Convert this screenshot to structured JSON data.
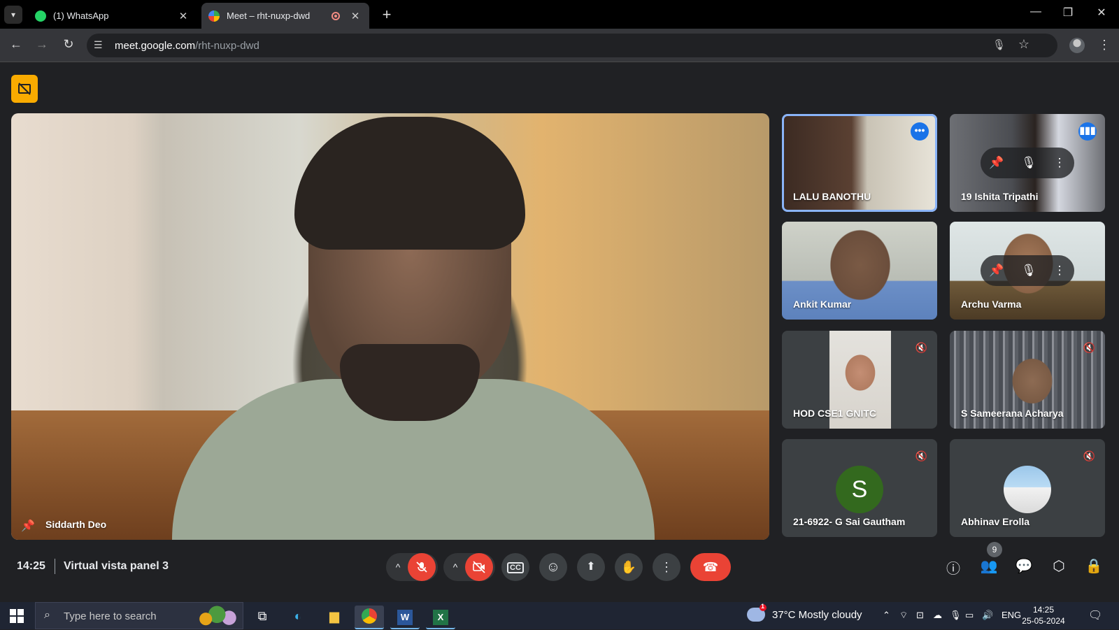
{
  "browser": {
    "tabs": [
      {
        "title": "(1) WhatsApp",
        "close": "✕"
      },
      {
        "title": "Meet – rht-nuxp-dwd",
        "close": "✕"
      }
    ],
    "url_host": "meet.google.com",
    "url_path": "/rht-nuxp-dwd"
  },
  "meet": {
    "main_speaker": "Siddarth Deo",
    "participants": [
      {
        "name": "LALU BANOTHU"
      },
      {
        "name": "19 Ishita Tripathi"
      },
      {
        "name": "Ankit Kumar"
      },
      {
        "name": "Archu Varma"
      },
      {
        "name": "HOD CSE1 GNITC"
      },
      {
        "name": "S Sameerana Acharya"
      },
      {
        "name": "21-6922- G Sai Gautham",
        "avatar_letter": "S"
      },
      {
        "name": "Abhinav Erolla"
      }
    ],
    "time": "14:25",
    "meeting_name": "Virtual vista panel 3",
    "people_count": "9"
  },
  "taskbar": {
    "search_placeholder": "Type here to search",
    "weather": "37°C  Mostly cloudy",
    "language": "ENG",
    "clock_time": "14:25",
    "clock_date": "25-05-2024",
    "weather_alert": "1"
  },
  "colors": {
    "accent": "#1a73e8",
    "danger": "#ea4335",
    "badge": "#f9ab00"
  }
}
